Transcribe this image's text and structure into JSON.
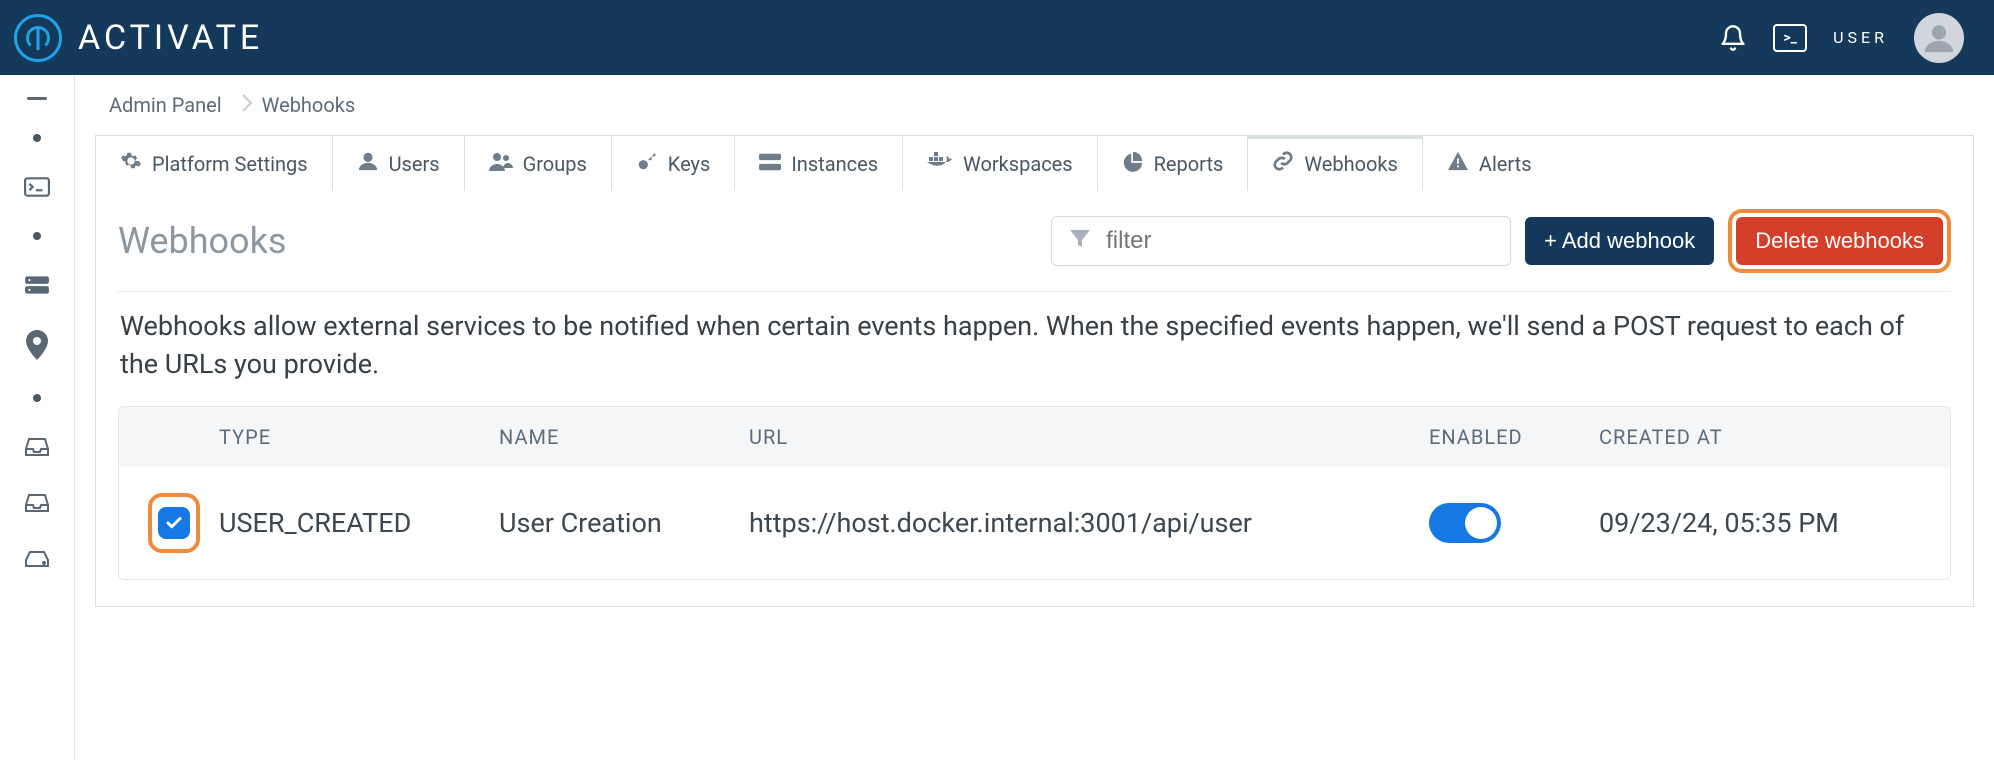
{
  "brand": "ACTIVATE",
  "user_label": "USER",
  "breadcrumb": {
    "root": "Admin Panel",
    "current": "Webhooks"
  },
  "tabs": [
    {
      "label": "Platform Settings",
      "icon": "gear-icon"
    },
    {
      "label": "Users",
      "icon": "user-icon"
    },
    {
      "label": "Groups",
      "icon": "users-group-icon"
    },
    {
      "label": "Keys",
      "icon": "key-icon"
    },
    {
      "label": "Instances",
      "icon": "server-icon"
    },
    {
      "label": "Workspaces",
      "icon": "docker-icon"
    },
    {
      "label": "Reports",
      "icon": "pie-chart-icon"
    },
    {
      "label": "Webhooks",
      "icon": "link-icon",
      "active": true
    },
    {
      "label": "Alerts",
      "icon": "alert-icon"
    }
  ],
  "panel": {
    "title": "Webhooks",
    "filter_placeholder": "filter",
    "add_button": "+ Add webhook",
    "delete_button": "Delete webhooks",
    "description": "Webhooks allow external services to be notified when certain events happen. When the specified events happen, we'll send a POST request to each of the URLs you provide."
  },
  "table": {
    "headers": {
      "type": "TYPE",
      "name": "NAME",
      "url": "URL",
      "enabled": "ENABLED",
      "created": "CREATED AT"
    },
    "rows": [
      {
        "checked": true,
        "type": "USER_CREATED",
        "name": "User Creation",
        "url": "https://host.docker.internal:3001/api/user",
        "enabled": true,
        "created": "09/23/24, 05:35 PM"
      }
    ]
  }
}
